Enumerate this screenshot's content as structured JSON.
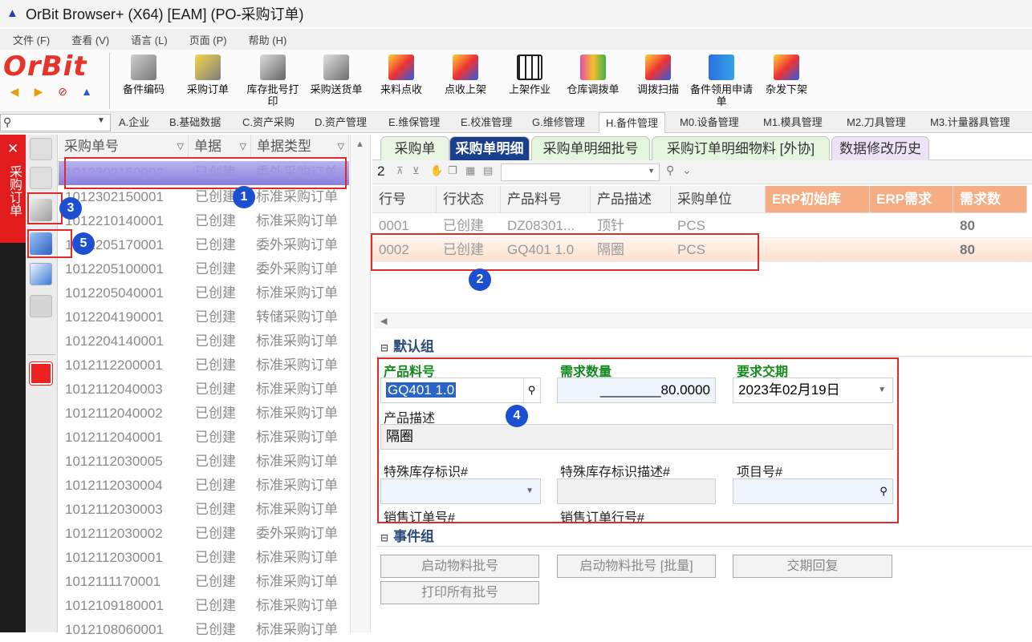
{
  "window": {
    "title": "OrBit Browser+ (X64) [EAM] (PO-采购订单)"
  },
  "menu": [
    "文件 (F)",
    "查看 (V)",
    "语言 (L)",
    "页面 (P)",
    "帮助 (H)"
  ],
  "brand": "OrBit",
  "toolbar": [
    {
      "label": "备件编码",
      "icon": "part-code-icon"
    },
    {
      "label": "采购订单",
      "icon": "shopping-cart-icon"
    },
    {
      "label": "库存批号打印",
      "icon": "stock-print-icon"
    },
    {
      "label": "采购送货单",
      "icon": "delivery-note-icon"
    },
    {
      "label": "来料点收",
      "icon": "receive-icon"
    },
    {
      "label": "点收上架",
      "icon": "shelve-icon"
    },
    {
      "label": "上架作业",
      "icon": "grid-up-icon"
    },
    {
      "label": "仓库调拨单",
      "icon": "transfer-icon"
    },
    {
      "label": "调拨扫描",
      "icon": "scan-icon"
    },
    {
      "label": "备件领用申请单",
      "icon": "request-icon"
    },
    {
      "label": "杂发下架",
      "icon": "misc-issue-icon"
    }
  ],
  "nav_tabs": [
    "A.企业",
    "B.基础数据",
    "C.资产采购",
    "D.资产管理",
    "E.维保管理",
    "E.校准管理",
    "G.维修管理",
    "H.备件管理",
    "M0.设备管理",
    "M1.模具管理",
    "M2.刀具管理",
    "M3.计量器具管理"
  ],
  "nav_active": "H.备件管理",
  "side_vertical_label": "采购订单",
  "left_grid": {
    "headers": [
      "采购单号",
      "单据",
      "单据类型"
    ],
    "rows": [
      [
        "1012302150002",
        "已创建",
        "委外采购订单"
      ],
      [
        "1012302150001",
        "已创建",
        "标准采购订单"
      ],
      [
        "1012210140001",
        "已创建",
        "标准采购订单"
      ],
      [
        "1012205170001",
        "已创建",
        "委外采购订单"
      ],
      [
        "1012205100001",
        "已创建",
        "委外采购订单"
      ],
      [
        "1012205040001",
        "已创建",
        "标准采购订单"
      ],
      [
        "1012204190001",
        "已创建",
        "转储采购订单"
      ],
      [
        "1012204140001",
        "已创建",
        "标准采购订单"
      ],
      [
        "1012112200001",
        "已创建",
        "标准采购订单"
      ],
      [
        "1012112040003",
        "已创建",
        "标准采购订单"
      ],
      [
        "1012112040002",
        "已创建",
        "标准采购订单"
      ],
      [
        "1012112040001",
        "已创建",
        "标准采购订单"
      ],
      [
        "1012112030005",
        "已创建",
        "标准采购订单"
      ],
      [
        "1012112030004",
        "已创建",
        "标准采购订单"
      ],
      [
        "1012112030003",
        "已创建",
        "标准采购订单"
      ],
      [
        "1012112030002",
        "已创建",
        "委外采购订单"
      ],
      [
        "1012112030001",
        "已创建",
        "标准采购订单"
      ],
      [
        "1012111170001",
        "已创建",
        "标准采购订单"
      ],
      [
        "1012109180001",
        "已创建",
        "标准采购订单"
      ],
      [
        "1012108060001",
        "已创建",
        "标准采购订单"
      ]
    ]
  },
  "right_tabs": [
    "采购单",
    "采购单明细",
    "采购单明细批号",
    "采购订单明细物料 [外协]",
    "数据修改历史"
  ],
  "right_tab_active": "采购单明细",
  "grid_count": "2",
  "detail_grid": {
    "headers": [
      "行号",
      "行状态",
      "产品料号",
      "产品描述",
      "采购单位",
      "ERP初始库",
      "ERP需求",
      "需求数"
    ],
    "rows": [
      [
        "0001",
        "已创建",
        "DZ08301...",
        "顶针",
        "PCS",
        "",
        "",
        "80"
      ],
      [
        "0002",
        "已创建",
        "GQ401 1.0",
        "隔圈",
        "PCS",
        "",
        "",
        "80"
      ]
    ]
  },
  "form": {
    "group1": "默认组",
    "part_no_label": "产品料号",
    "part_no": "GQ401 1.0",
    "qty_label": "需求数量",
    "qty": "________80.0000",
    "due_label": "要求交期",
    "due": "2023年02月19日",
    "desc_label": "产品描述",
    "desc": "隔圈",
    "special_label": "特殊库存标识#",
    "special_desc_label": "特殊库存标识描述#",
    "project_label": "项目号#",
    "so_label": "销售订单号#",
    "so_line_label": "销售订单行号#",
    "group2": "事件组",
    "btn_batch": "启动物料批号",
    "btn_batch_bulk": "启动物料批号 [批量]",
    "btn_reply": "交期回复",
    "btn_print": "打印所有批号"
  },
  "badges": [
    "1",
    "2",
    "3",
    "4",
    "5"
  ],
  "colors": {
    "brand": "#e8332a",
    "active_tab": "#1b3f8f",
    "green_label": "#138a1e",
    "highlight": "#e02b2b",
    "badge": "#1d4fd2"
  }
}
